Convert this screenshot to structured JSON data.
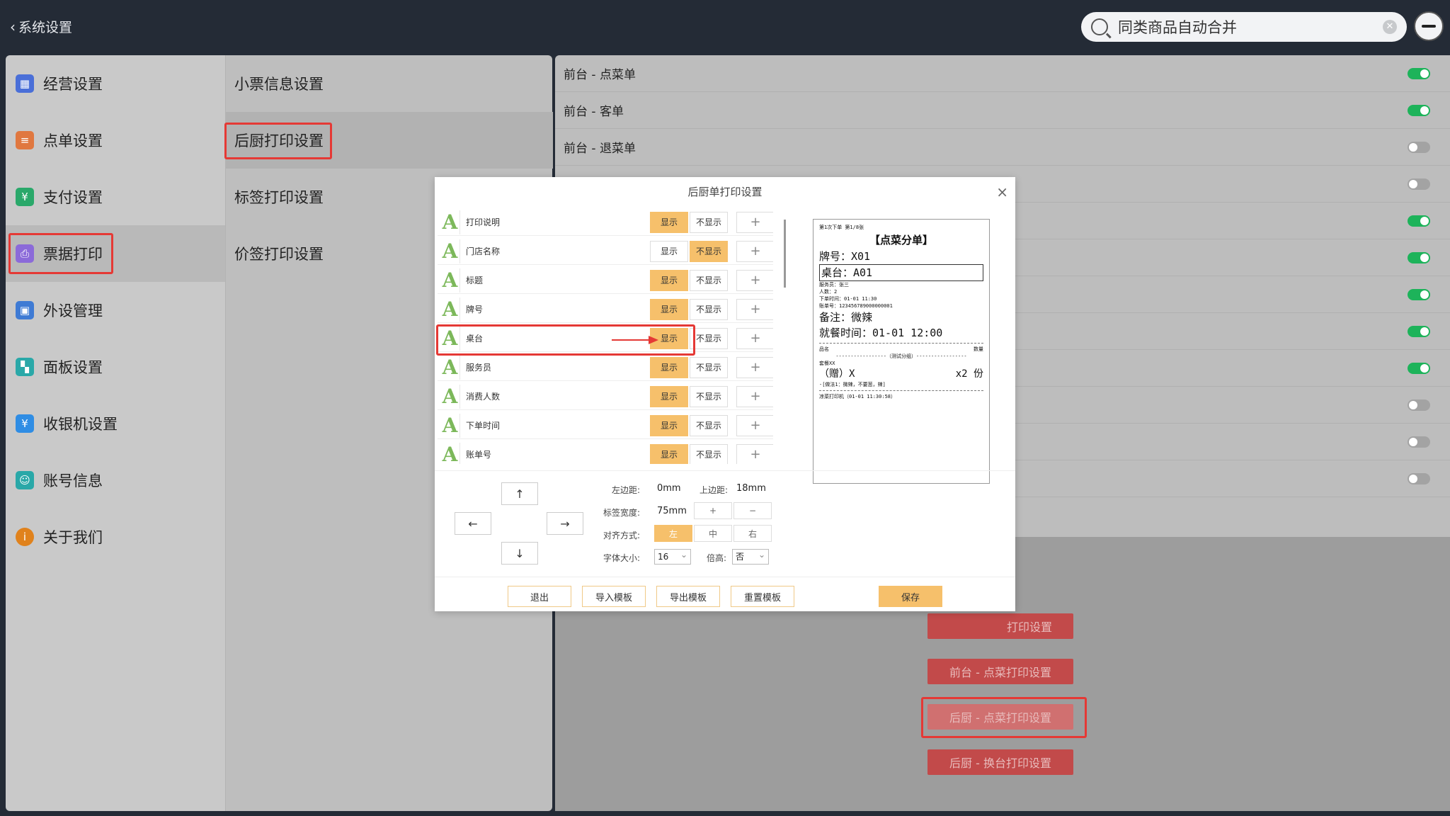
{
  "header": {
    "back_label": "系统设置",
    "search_value": "同类商品自动合并"
  },
  "sidebar": {
    "items": [
      {
        "label": "经营设置",
        "icon": "store-icon",
        "color": "#4a6fd8"
      },
      {
        "label": "点单设置",
        "icon": "order-icon",
        "color": "#e07840"
      },
      {
        "label": "支付设置",
        "icon": "payment-icon",
        "color": "#2aa86a"
      },
      {
        "label": "票据打印",
        "icon": "print-icon",
        "color": "#8b6ad9"
      },
      {
        "label": "外设管理",
        "icon": "device-icon",
        "color": "#3f7bd4"
      },
      {
        "label": "面板设置",
        "icon": "panel-icon",
        "color": "#2aa8a8"
      },
      {
        "label": "收银机设置",
        "icon": "cashier-icon",
        "color": "#2f8de4"
      },
      {
        "label": "账号信息",
        "icon": "account-icon",
        "color": "#2aa8a8"
      },
      {
        "label": "关于我们",
        "icon": "info-icon",
        "color": "#e0821c"
      }
    ]
  },
  "submenu": {
    "items": [
      "小票信息设置",
      "后厨打印设置",
      "标签打印设置",
      "价签打印设置"
    ]
  },
  "settings": {
    "rows": [
      {
        "label": "前台 - 点菜单",
        "on": true
      },
      {
        "label": "前台 - 客单",
        "on": true
      },
      {
        "label": "前台 - 退菜单",
        "on": false
      },
      {
        "label": "",
        "on": false
      },
      {
        "label": "",
        "on": true
      },
      {
        "label": "",
        "on": true
      },
      {
        "label": "",
        "on": true
      },
      {
        "label": "",
        "on": true
      },
      {
        "label": "",
        "on": true
      },
      {
        "label": "",
        "on": false
      },
      {
        "label": "",
        "on": false
      },
      {
        "label": "",
        "on": false
      }
    ]
  },
  "buttons": {
    "btn1": "打印设置",
    "btn2": "前台 - 点菜打印设置",
    "btn3": "后厨 - 点菜打印设置",
    "btn4": "后厨 - 换台打印设置"
  },
  "modal": {
    "title": "后厨单打印设置",
    "show_label": "显示",
    "hide_label": "不显示",
    "plus_label": "+",
    "fields": [
      {
        "name": "打印说明",
        "show": true
      },
      {
        "name": "门店名称",
        "show": false
      },
      {
        "name": "标题",
        "show": true
      },
      {
        "name": "牌号",
        "show": true
      },
      {
        "name": "桌台",
        "show": true
      },
      {
        "name": "服务员",
        "show": true
      },
      {
        "name": "消费人数",
        "show": true
      },
      {
        "name": "下单时间",
        "show": true
      },
      {
        "name": "账单号",
        "show": true
      }
    ],
    "preview": {
      "header_line": "第1次下单 第1/8张",
      "title": "【点菜分单】",
      "plate": "牌号：X01",
      "table": "桌台：A01",
      "waiter": "服务员：张三",
      "guests": "人数：2",
      "order_time": "下单时间：01-01 11:30",
      "bill_no": "账单号：123456789000000001",
      "remark": "备注：微辣",
      "dine_time": "就餐时间：01-01 12:00",
      "col_name": "品名",
      "col_qty": "数量",
      "group": "-----------------（测试分组）-----------------",
      "combo": "套餐XX",
      "item": "（赠）X",
      "item_qty": "x2 份",
      "item_note": "-[做法1：微辣，不要葱，辣]",
      "footer": "凉菜打印机（01-01 11:30:58）"
    },
    "controls": {
      "up": "↑",
      "down": "↓",
      "left": "←",
      "right": "→",
      "left_margin_label": "左边距:",
      "left_margin": "0mm",
      "top_margin_label": "上边距:",
      "top_margin": "18mm",
      "width_label": "标签宽度:",
      "width": "75mm",
      "inc": "+",
      "dec": "−",
      "align_label": "对齐方式:",
      "align_left": "左",
      "align_center": "中",
      "align_right": "右",
      "font_label": "字体大小:",
      "font_size": "16",
      "double_label": "倍高:",
      "double": "否"
    },
    "footer": {
      "exit": "退出",
      "import": "导入模板",
      "export": "导出模板",
      "reset": "重置模板",
      "save": "保存"
    }
  }
}
